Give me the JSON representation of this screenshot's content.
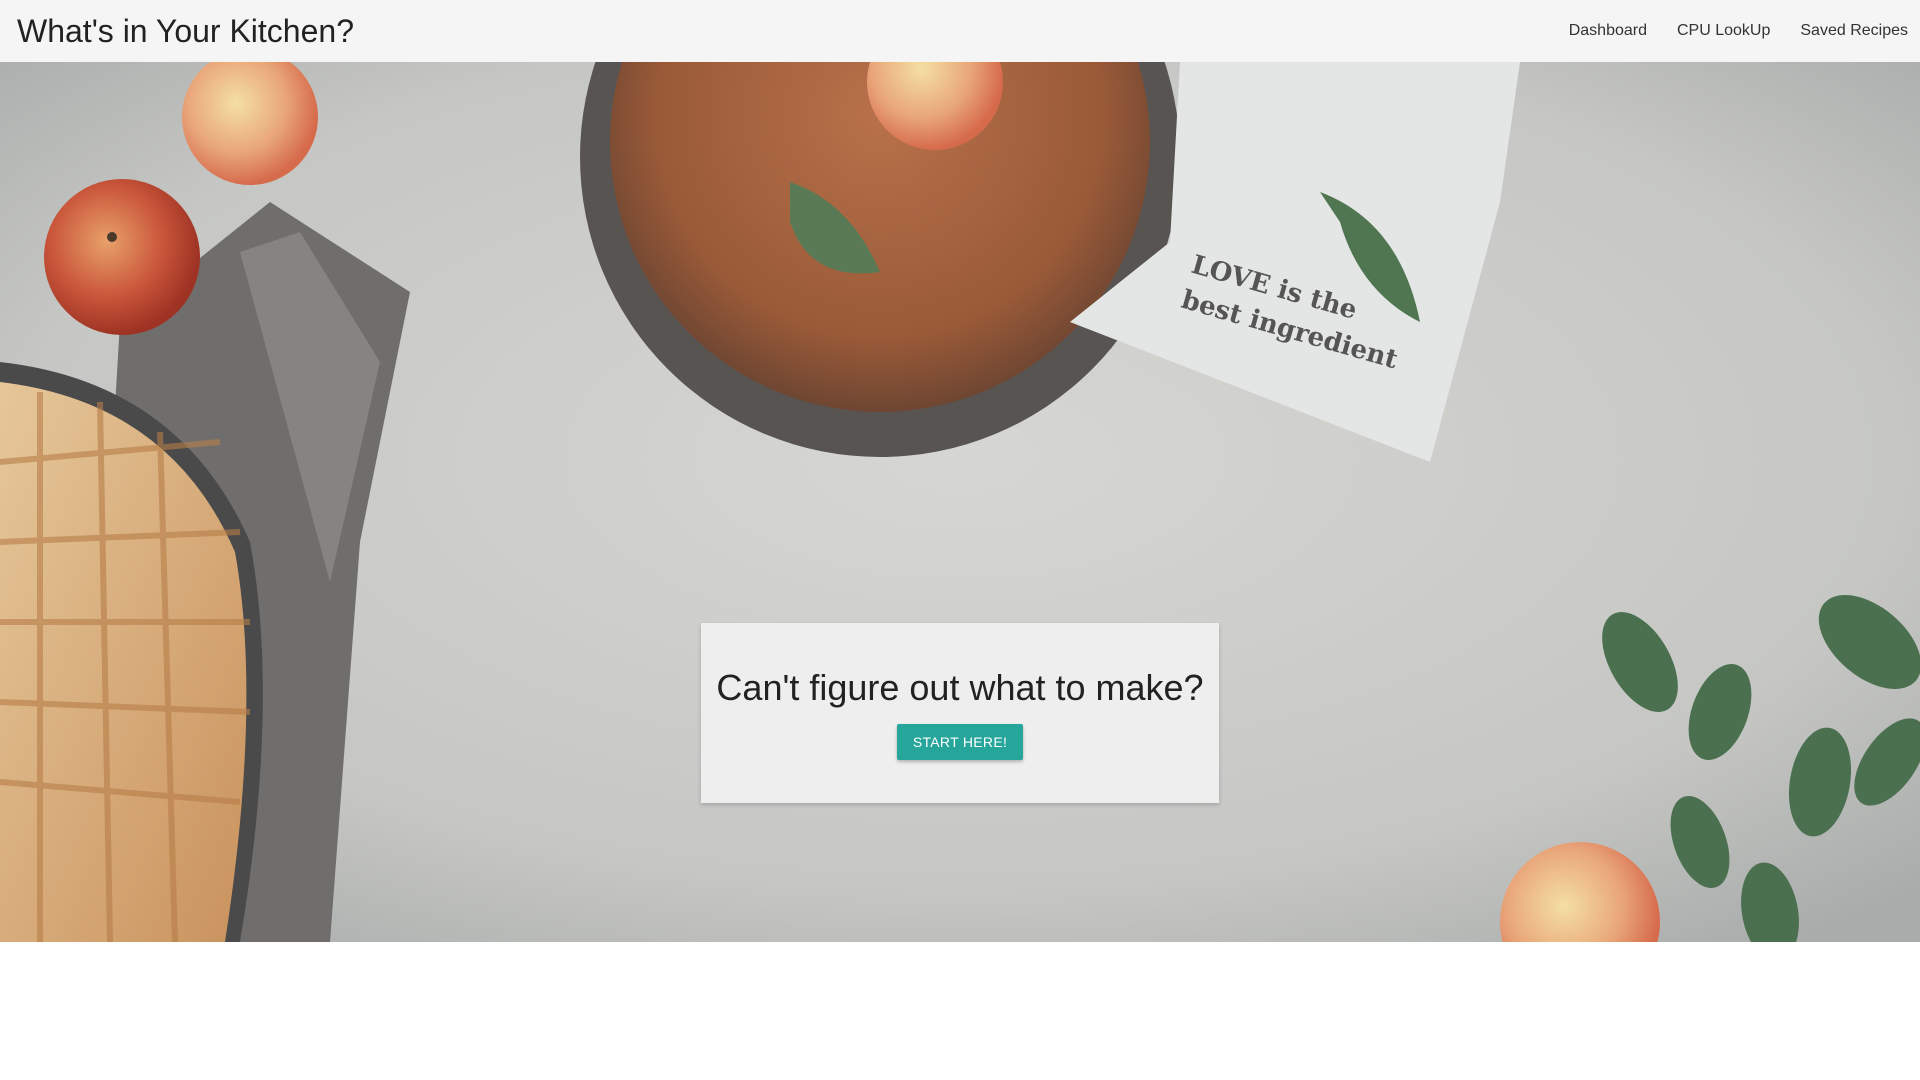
{
  "navbar": {
    "brand": "What's in Your Kitchen?",
    "links": [
      {
        "label": "Dashboard"
      },
      {
        "label": "CPU LookUp"
      },
      {
        "label": "Saved Recipes"
      }
    ]
  },
  "hero": {
    "image_description_icon": "kitchen-table-photo",
    "towel_text_line1": "LOVE is the",
    "towel_text_line2": "best ingredient"
  },
  "cta": {
    "heading": "Can't figure out what to make?",
    "button_label": "START HERE!"
  },
  "colors": {
    "navbar_bg": "#f5f5f5",
    "button_bg": "#26a69a",
    "card_bg": "#eeeeee"
  }
}
